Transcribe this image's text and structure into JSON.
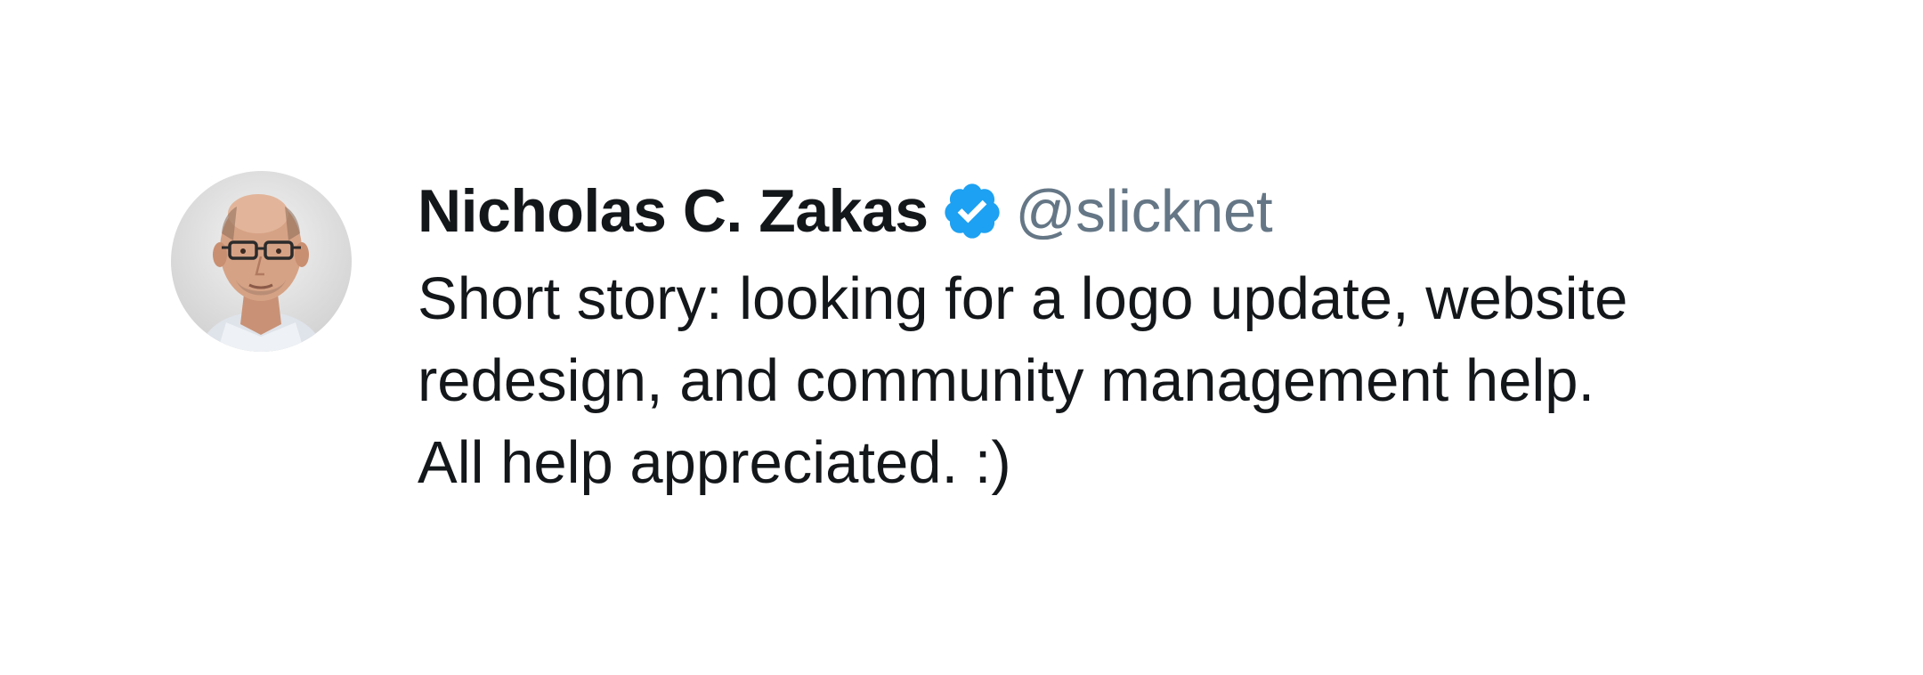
{
  "tweet": {
    "author": {
      "display_name": "Nicholas C. Zakas",
      "handle": "@slicknet",
      "verified": true,
      "avatar_icon": "profile-photo",
      "verified_icon": "verified-badge-icon"
    },
    "text_lines": [
      "Short story: looking for a logo update, website",
      "redesign, and community management help.",
      "All help appreciated. :)"
    ]
  },
  "colors": {
    "name": "#14171a",
    "handle": "#657786",
    "verified_badge": "#1da1f2",
    "background": "#ffffff"
  }
}
